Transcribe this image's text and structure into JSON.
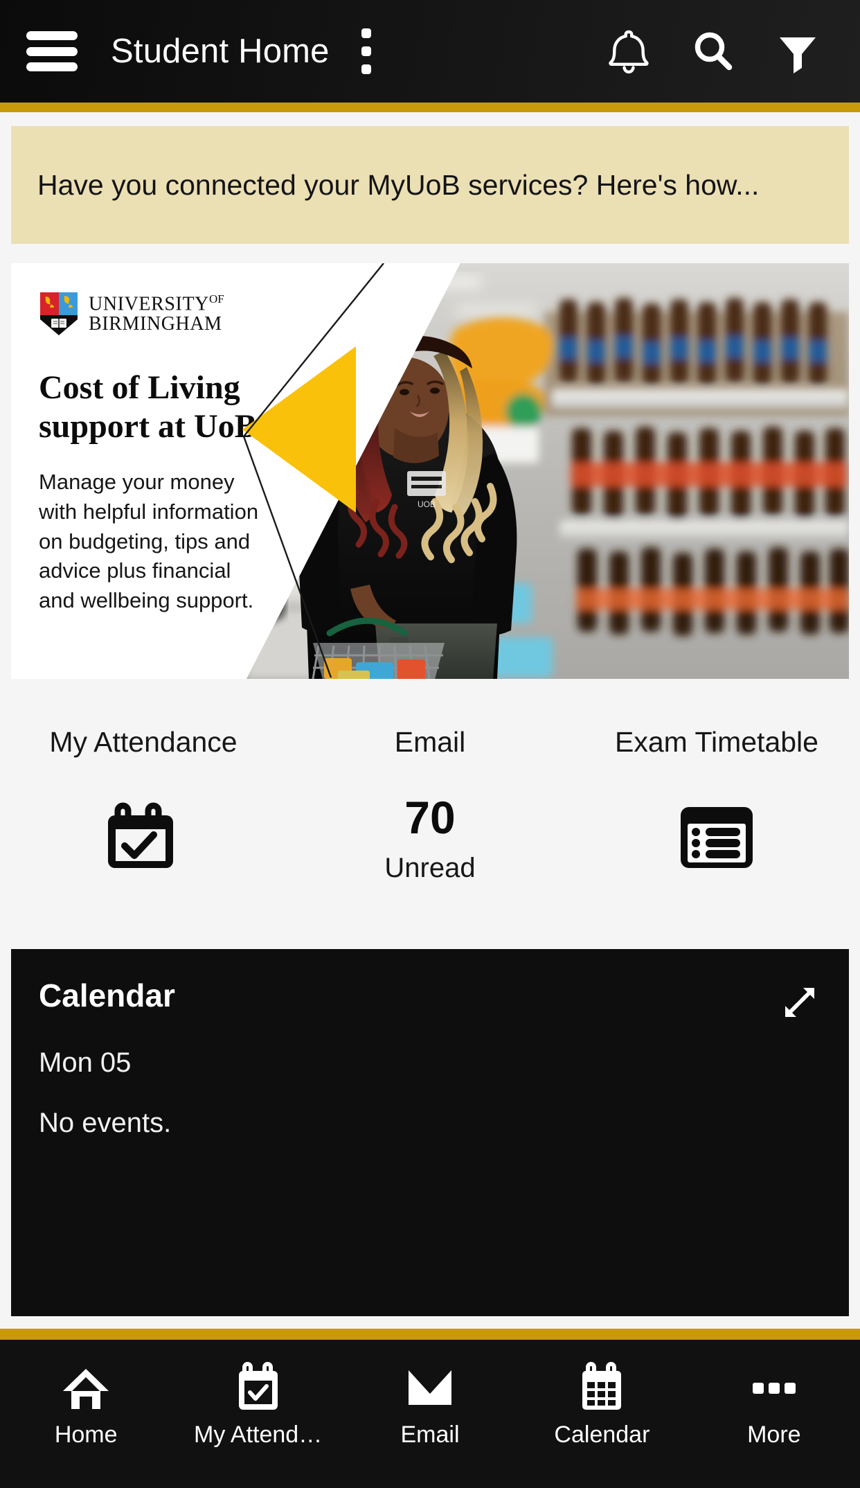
{
  "appbar": {
    "menu_icon": "hamburger-menu-icon",
    "title": "Student Home",
    "overflow_icon": "kebab-menu-icon",
    "notifications_icon": "bell-icon",
    "search_icon": "search-icon",
    "filter_icon": "funnel-filter-icon"
  },
  "announcement": {
    "text": "Have you connected your MyUoB services? Here's how..."
  },
  "promo": {
    "university_line1": "UNIVERSITY",
    "university_sup": "OF",
    "university_line2": "BIRMINGHAM",
    "crest_icon": "university-crest-icon",
    "heading": "Cost of Living support at UoB",
    "body": "Manage your money with helpful information on budgeting, tips and advice plus financial and wellbeing support.",
    "accent_yellow": "#F9C10A"
  },
  "tiles": [
    {
      "label": "My Attendance",
      "icon": "calendar-check-icon",
      "count": "",
      "sub": ""
    },
    {
      "label": "Email",
      "icon": "",
      "count": "70",
      "sub": "Unread"
    },
    {
      "label": "Exam Timetable",
      "icon": "timetable-list-icon",
      "count": "",
      "sub": ""
    }
  ],
  "calendar": {
    "title": "Calendar",
    "expand_icon": "expand-diagonal-icon",
    "date": "Mon 05",
    "events": "No events."
  },
  "bottomnav": [
    {
      "label": "Home",
      "icon": "home-icon"
    },
    {
      "label": "My Attend…",
      "icon": "calendar-check-icon"
    },
    {
      "label": "Email",
      "icon": "envelope-icon"
    },
    {
      "label": "Calendar",
      "icon": "calendar-grid-icon"
    },
    {
      "label": "More",
      "icon": "more-dots-icon"
    }
  ],
  "colors": {
    "gold_rule": "#C89A0B",
    "announcement_bg": "#EBDFB4",
    "page_bg": "#F5F5F5",
    "appbar_bg": "#141414",
    "card_dark": "#0E0E0E"
  }
}
